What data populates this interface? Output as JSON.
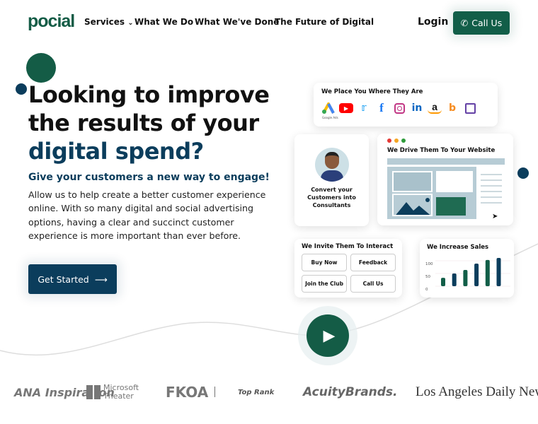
{
  "header": {
    "logo": "pocial",
    "nav": [
      {
        "label": "Services",
        "has_dropdown": true
      },
      {
        "label": "What We Do"
      },
      {
        "label": "What We've Done"
      },
      {
        "label": "The Future of Digital"
      }
    ],
    "login": "Login",
    "call_us": "Call Us"
  },
  "hero": {
    "title_line1": "Looking to improve",
    "title_line2": "the results of your",
    "title_line3": "digital spend?",
    "subtitle": "Give your customers a new way to engage!",
    "body": "Allow us to help create a better customer experience online. With so many digital and social advertising options, having a clear and succinct customer experience is more important than ever before.",
    "cta": "Get Started"
  },
  "illustration": {
    "place": {
      "title": "We Place You Where They Are",
      "icons": [
        "google-ads",
        "youtube",
        "twitter",
        "facebook",
        "instagram",
        "linkedin",
        "amazon",
        "bing",
        "twitch"
      ],
      "google_caption": "Google Ads"
    },
    "convert": {
      "text": "Convert your Customers into Consultants"
    },
    "drive": {
      "title": "We Drive Them To Your Website"
    },
    "interact": {
      "title": "We Invite Them To Interact",
      "buttons": [
        "Buy Now",
        "Feedback",
        "Join the Club",
        "Call Us"
      ]
    },
    "sales": {
      "title": "We Increase Sales",
      "axis_ticks": [
        "100",
        "50",
        "0"
      ],
      "bars": [
        33,
        50,
        64,
        89,
        103,
        111
      ]
    }
  },
  "clients": [
    "ANA Inspiration",
    "Microsoft Theater",
    "FKOA Presents",
    "Top Rank",
    "AcuityBrands.",
    "Los Angeles Daily News"
  ],
  "colors": {
    "green": "#125e48",
    "navy": "#0b3d5c",
    "accent_light": "#b7ccd5"
  }
}
